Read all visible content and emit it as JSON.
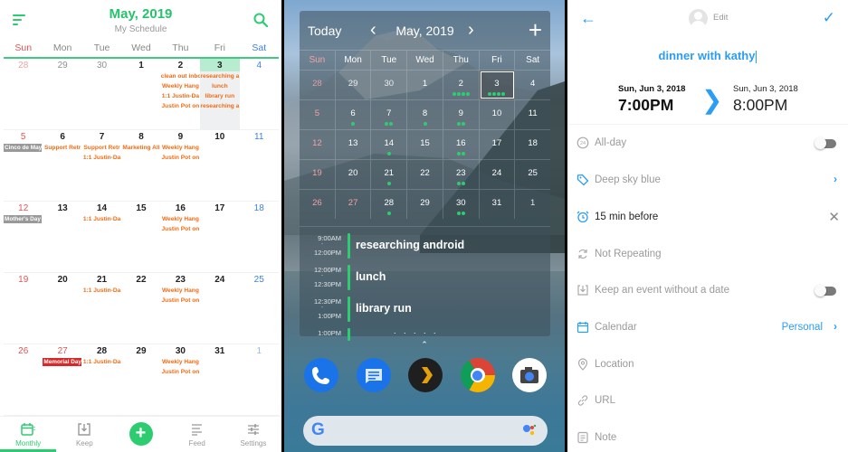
{
  "monthly": {
    "title": "May, 2019",
    "subtitle": "My Schedule",
    "weekdays": [
      "Sun",
      "Mon",
      "Tue",
      "Wed",
      "Thu",
      "Fri",
      "Sat"
    ],
    "accent": "#2ecc71",
    "weeks": [
      [
        {
          "n": "28",
          "other": true,
          "ev": [],
          "hol": null
        },
        {
          "n": "29",
          "other": true,
          "ev": [],
          "hol": null
        },
        {
          "n": "30",
          "other": true,
          "ev": [],
          "hol": null
        },
        {
          "n": "1",
          "ev": [],
          "hol": null
        },
        {
          "n": "2",
          "ev": [
            "clean out inbox",
            "Weekly Hang",
            "1:1 Justin-Da",
            "Justin Pot on"
          ],
          "hol": null
        },
        {
          "n": "3",
          "today": true,
          "ev": [
            "researching a",
            "lunch",
            "library run",
            "researching a"
          ],
          "hol": null
        },
        {
          "n": "4",
          "ev": [],
          "hol": null
        }
      ],
      [
        {
          "n": "5",
          "ev": [],
          "hol": "Cinco de Mayo"
        },
        {
          "n": "6",
          "ev": [
            "Support Retr"
          ],
          "hol": null
        },
        {
          "n": "7",
          "ev": [
            "Support Retr",
            "1:1 Justin-Da"
          ],
          "hol": null
        },
        {
          "n": "8",
          "ev": [
            "Marketing All"
          ],
          "hol": null
        },
        {
          "n": "9",
          "ev": [
            "Weekly Hang",
            "Justin Pot on"
          ],
          "hol": null
        },
        {
          "n": "10",
          "ev": [],
          "hol": null
        },
        {
          "n": "11",
          "ev": [],
          "hol": null
        }
      ],
      [
        {
          "n": "12",
          "ev": [],
          "hol": "Mother's Day"
        },
        {
          "n": "13",
          "ev": [],
          "hol": null
        },
        {
          "n": "14",
          "ev": [
            "1:1 Justin-Da"
          ],
          "hol": null
        },
        {
          "n": "15",
          "ev": [],
          "hol": null
        },
        {
          "n": "16",
          "ev": [
            "Weekly Hang",
            "Justin Pot on"
          ],
          "hol": null
        },
        {
          "n": "17",
          "ev": [],
          "hol": null
        },
        {
          "n": "18",
          "ev": [],
          "hol": null
        }
      ],
      [
        {
          "n": "19",
          "ev": [],
          "hol": null
        },
        {
          "n": "20",
          "ev": [],
          "hol": null
        },
        {
          "n": "21",
          "ev": [
            "1:1 Justin-Da"
          ],
          "hol": null
        },
        {
          "n": "22",
          "ev": [],
          "hol": null
        },
        {
          "n": "23",
          "ev": [
            "Weekly Hang",
            "Justin Pot on"
          ],
          "hol": null
        },
        {
          "n": "24",
          "ev": [],
          "hol": null
        },
        {
          "n": "25",
          "ev": [],
          "hol": null
        }
      ],
      [
        {
          "n": "26",
          "ev": [],
          "hol": null
        },
        {
          "n": "27",
          "ev": [],
          "hol": "Memorial Day",
          "holRed": true,
          "sunRed": true
        },
        {
          "n": "28",
          "ev": [
            "1:1 Justin-Da"
          ],
          "hol": null
        },
        {
          "n": "29",
          "ev": [],
          "hol": null
        },
        {
          "n": "30",
          "ev": [
            "Weekly Hang",
            "Justin Pot on"
          ],
          "hol": null
        },
        {
          "n": "31",
          "ev": [],
          "hol": null
        },
        {
          "n": "1",
          "other": true,
          "ev": [],
          "hol": null
        }
      ]
    ],
    "nav": [
      {
        "label": "Monthly",
        "icon": "calendar-icon",
        "active": true
      },
      {
        "label": "Keep",
        "icon": "keep-icon"
      },
      {
        "label": "",
        "icon": "add-icon",
        "fab": true
      },
      {
        "label": "Feed",
        "icon": "feed-icon"
      },
      {
        "label": "Settings",
        "icon": "settings-icon"
      }
    ]
  },
  "widget": {
    "today_label": "Today",
    "month": "May, 2019",
    "weekdays": [
      "Sun",
      "Mon",
      "Tue",
      "Wed",
      "Thu",
      "Fri",
      "Sat"
    ],
    "weeks": [
      [
        {
          "n": "28",
          "d": 0
        },
        {
          "n": "29",
          "d": 0
        },
        {
          "n": "30",
          "d": 0
        },
        {
          "n": "1",
          "d": 0
        },
        {
          "n": "2",
          "d": 4
        },
        {
          "n": "3",
          "d": 4,
          "sel": true
        },
        {
          "n": "4",
          "d": 0
        }
      ],
      [
        {
          "n": "5",
          "d": 0
        },
        {
          "n": "6",
          "d": 1
        },
        {
          "n": "7",
          "d": 2
        },
        {
          "n": "8",
          "d": 1
        },
        {
          "n": "9",
          "d": 2
        },
        {
          "n": "10",
          "d": 0
        },
        {
          "n": "11",
          "d": 0
        }
      ],
      [
        {
          "n": "12",
          "d": 0
        },
        {
          "n": "13",
          "d": 0
        },
        {
          "n": "14",
          "d": 1
        },
        {
          "n": "15",
          "d": 0
        },
        {
          "n": "16",
          "d": 2
        },
        {
          "n": "17",
          "d": 0
        },
        {
          "n": "18",
          "d": 0
        }
      ],
      [
        {
          "n": "19",
          "d": 0
        },
        {
          "n": "20",
          "d": 0
        },
        {
          "n": "21",
          "d": 1
        },
        {
          "n": "22",
          "d": 0
        },
        {
          "n": "23",
          "d": 2
        },
        {
          "n": "24",
          "d": 0
        },
        {
          "n": "25",
          "d": 0
        }
      ],
      [
        {
          "n": "26",
          "d": 0
        },
        {
          "n": "27",
          "d": 0
        },
        {
          "n": "28",
          "d": 1
        },
        {
          "n": "29",
          "d": 0
        },
        {
          "n": "30",
          "d": 2
        },
        {
          "n": "31",
          "d": 0
        },
        {
          "n": "1",
          "d": 0
        }
      ]
    ],
    "agenda": [
      {
        "start": "9:00AM",
        "end": "12:00PM",
        "title": "researching android"
      },
      {
        "start": "12:00PM",
        "end": "12:30PM",
        "title": "lunch"
      },
      {
        "start": "12:30PM",
        "end": "1:00PM",
        "title": "library run"
      },
      {
        "start": "1:00PM",
        "end": "",
        "title": ""
      }
    ],
    "dock_apps": [
      "Phone",
      "Messages",
      "Plex",
      "Chrome",
      "Camera"
    ],
    "search_logo": "G"
  },
  "editor": {
    "edit_label": "Edit",
    "title": "dinner with kathy",
    "start_date": "Sun, Jun 3, 2018",
    "start_time": "7:00PM",
    "end_date": "Sun, Jun 3, 2018",
    "end_time": "8:00PM",
    "accent": "#2a9df4",
    "rows": {
      "allday": "All-day",
      "color": "Deep sky blue",
      "reminder": "15 min before",
      "repeat": "Not Repeating",
      "keep": "Keep an event without a date",
      "calendar": "Calendar",
      "calendar_value": "Personal",
      "location": "Location",
      "url": "URL",
      "note": "Note"
    },
    "allday_on": false,
    "keep_on": false
  }
}
